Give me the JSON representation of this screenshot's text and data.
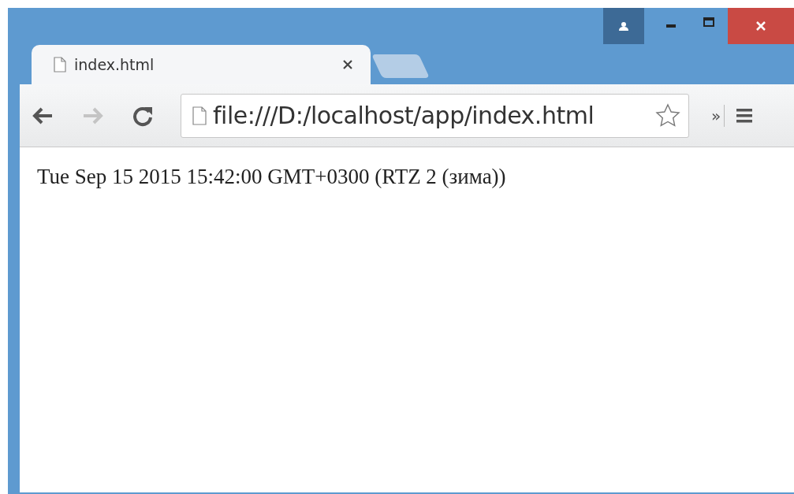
{
  "tabs": [
    {
      "title": "index.html",
      "selected": true
    }
  ],
  "toolbar": {
    "back": {
      "disabled": false
    },
    "forward": {
      "disabled": true
    },
    "address": "file:///D:/localhost/app/index.html",
    "overflow": "»"
  },
  "page": {
    "text": "Tue Sep 15 2015 15:42:00 GMT+0300 (RTZ 2 (зима))"
  }
}
